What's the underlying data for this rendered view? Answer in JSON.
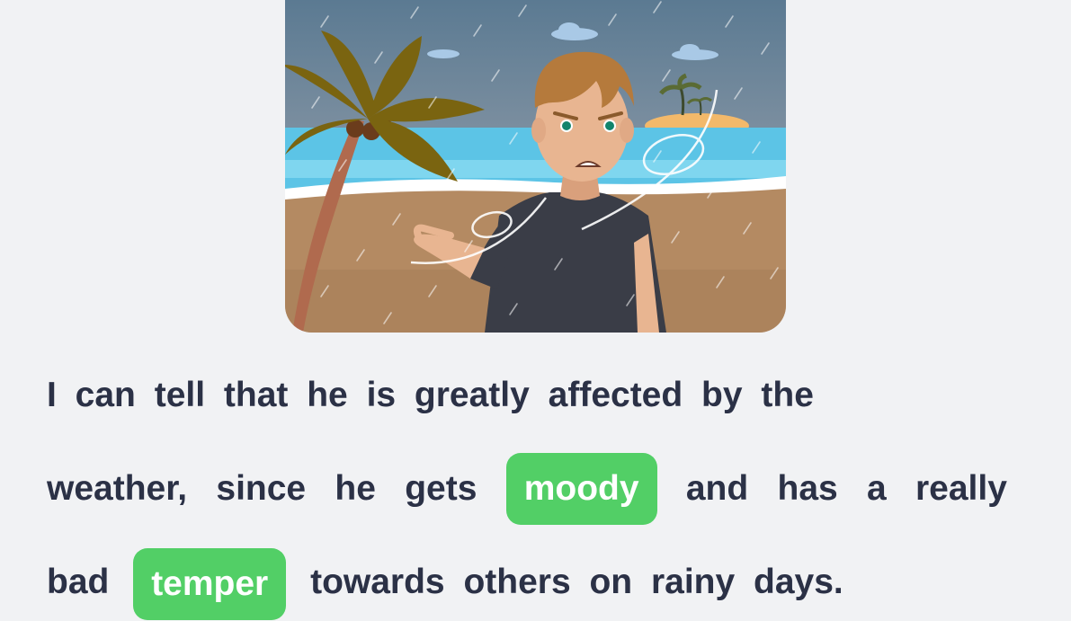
{
  "illustration": {
    "icon": "rainy-beach-man-illustration"
  },
  "sentence": {
    "line1": "I can tell that he is greatly affected by the",
    "line2_words": [
      "weather,",
      "since",
      "he",
      "gets"
    ],
    "blank1": "moody",
    "line2_after": [
      "and",
      "has",
      "a",
      "really"
    ],
    "line3_before": "bad",
    "blank2": "temper",
    "line3_after": "towards others on rainy days."
  },
  "colors": {
    "text": "#2b3146",
    "blank_bg": "#52cf66",
    "background": "#f1f2f4"
  }
}
